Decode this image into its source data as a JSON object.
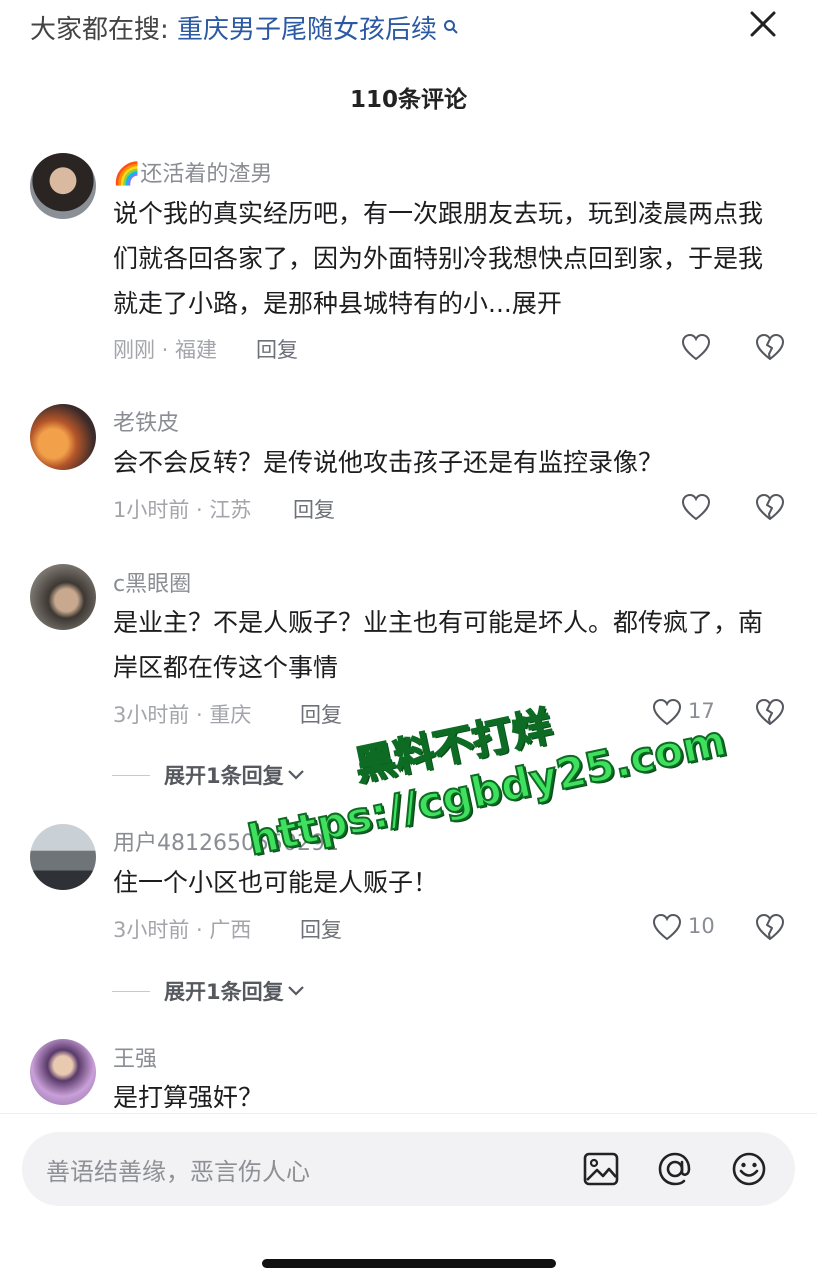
{
  "header": {
    "search_prefix": "大家都在搜: ",
    "search_query": "重庆男子尾随女孩后续",
    "search_icon": "search-icon",
    "close_icon": "close-icon",
    "title": "110条评论"
  },
  "comments": [
    {
      "username": "🌈还活着的渣男",
      "text": "说个我的真实经历吧，有一次跟朋友去玩，玩到凌晨两点我们就各回各家了，因为外面特别冷我想快点回到家，于是我就走了小路，是那种县城特有的小...展开",
      "meta": "刚刚 · 福建",
      "reply": "回复",
      "likes": ""
    },
    {
      "username": "老铁皮",
      "text": "会不会反转？是传说他攻击孩子还是有监控录像？",
      "meta": "1小时前 · 江苏",
      "reply": "回复",
      "likes": ""
    },
    {
      "username": "c黑眼圈",
      "text": "是业主？不是人贩子？业主也有可能是坏人。都传疯了，南岸区都在传这个事情",
      "meta": "3小时前 · 重庆",
      "reply": "回复",
      "likes": "17",
      "expand": "展开1条回复"
    },
    {
      "username": "用户4812650550291",
      "text": "住一个小区也可能是人贩子！",
      "meta": "3小时前 · 广西",
      "reply": "回复",
      "likes": "10",
      "expand": "展开1条回复"
    },
    {
      "username": "王强",
      "text": "是打算强奸？"
    }
  ],
  "watermark": {
    "line1": "黑料不打烊",
    "line2": "https://cgbdy25.com"
  },
  "input": {
    "placeholder": "善语结善缘，恶言伤人心",
    "icons": [
      "image-icon",
      "at-icon",
      "emoji-icon"
    ]
  }
}
